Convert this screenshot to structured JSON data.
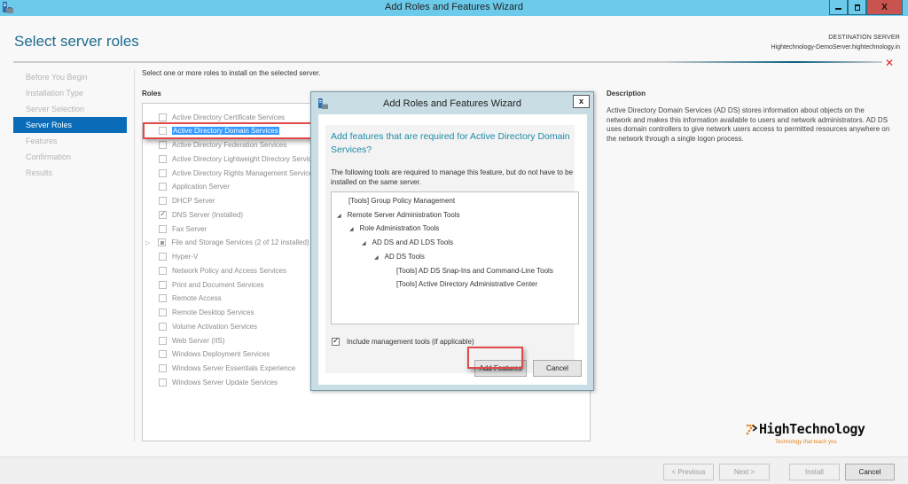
{
  "window": {
    "title": "Add Roles and Features Wizard",
    "minimize_icon": "minimize-icon",
    "restore_icon": "restore-icon",
    "close_label": "X"
  },
  "header": {
    "page_title": "Select server roles",
    "destination_label": "DESTINATION SERVER",
    "destination_server": "Hightechnology-DemoServer.hightechnology.in",
    "error_icon": "✕"
  },
  "nav": {
    "items": [
      {
        "label": "Before You Begin",
        "active": false
      },
      {
        "label": "Installation Type",
        "active": false
      },
      {
        "label": "Server Selection",
        "active": false
      },
      {
        "label": "Server Roles",
        "active": true
      },
      {
        "label": "Features",
        "active": false
      },
      {
        "label": "Confirmation",
        "active": false
      },
      {
        "label": "Results",
        "active": false
      }
    ]
  },
  "main": {
    "instruction": "Select one or more roles to install on the selected server.",
    "roles_label": "Roles",
    "roles": [
      {
        "label": "Active Directory Certificate Services",
        "state": "unchecked"
      },
      {
        "label": "Active Directory Domain Services",
        "state": "unchecked",
        "selected": true
      },
      {
        "label": "Active Directory Federation Services",
        "state": "unchecked"
      },
      {
        "label": "Active Directory Lightweight Directory Services",
        "state": "unchecked"
      },
      {
        "label": "Active Directory Rights Management Services",
        "state": "unchecked"
      },
      {
        "label": "Application Server",
        "state": "unchecked"
      },
      {
        "label": "DHCP Server",
        "state": "unchecked"
      },
      {
        "label": "DNS Server (Installed)",
        "state": "checked"
      },
      {
        "label": "Fax Server",
        "state": "unchecked"
      },
      {
        "label": "File and Storage Services (2 of 12 installed)",
        "state": "partial",
        "expandable": true
      },
      {
        "label": "Hyper-V",
        "state": "unchecked"
      },
      {
        "label": "Network Policy and Access Services",
        "state": "unchecked"
      },
      {
        "label": "Print and Document Services",
        "state": "unchecked"
      },
      {
        "label": "Remote Access",
        "state": "unchecked"
      },
      {
        "label": "Remote Desktop Services",
        "state": "unchecked"
      },
      {
        "label": "Volume Activation Services",
        "state": "unchecked"
      },
      {
        "label": "Web Server (IIS)",
        "state": "unchecked"
      },
      {
        "label": "Windows Deployment Services",
        "state": "unchecked"
      },
      {
        "label": "Windows Server Essentials Experience",
        "state": "unchecked"
      },
      {
        "label": "Windows Server Update Services",
        "state": "unchecked"
      }
    ],
    "description_title": "Description",
    "description_text": "Active Directory Domain Services (AD DS) stores information about objects on the network and makes this information available to users and network administrators. AD DS uses domain controllers to give network users access to permitted resources anywhere on the network through a single logon process."
  },
  "dialog": {
    "title": "Add Roles and Features Wizard",
    "close_label": "x",
    "heading": "Add features that are required for Active Directory Domain Services?",
    "text": "The following tools are required to manage this feature, but do not have to be installed on the same server.",
    "tree": [
      {
        "label": "[Tools] Group Policy Management",
        "level": 0,
        "expanded": null
      },
      {
        "label": "Remote Server Administration Tools",
        "level": 0,
        "expanded": true
      },
      {
        "label": "Role Administration Tools",
        "level": 1,
        "expanded": true
      },
      {
        "label": "AD DS and AD LDS Tools",
        "level": 2,
        "expanded": true
      },
      {
        "label": "AD DS Tools",
        "level": 3,
        "expanded": true
      },
      {
        "label": "[Tools] AD DS Snap-Ins and Command-Line Tools",
        "level": 4,
        "expanded": null
      },
      {
        "label": "[Tools] Active Directory Administrative Center",
        "level": 4,
        "expanded": null
      }
    ],
    "include_tools_label": "Include management tools (if applicable)",
    "include_tools_checked": true,
    "add_features_label": "Add Features",
    "cancel_label": "Cancel"
  },
  "footer": {
    "previous_label": "< Previous",
    "next_label": "Next >",
    "install_label": "Install",
    "cancel_label": "Cancel"
  },
  "logo": {
    "name": "HighTechnology",
    "tagline": "Technology that teach you"
  },
  "colors": {
    "titlebar": "#6ccbea",
    "accent": "#0a6cb8",
    "heading": "#1e6b8f",
    "highlight_box": "#e24a4a",
    "logo_orange": "#e8821e"
  }
}
